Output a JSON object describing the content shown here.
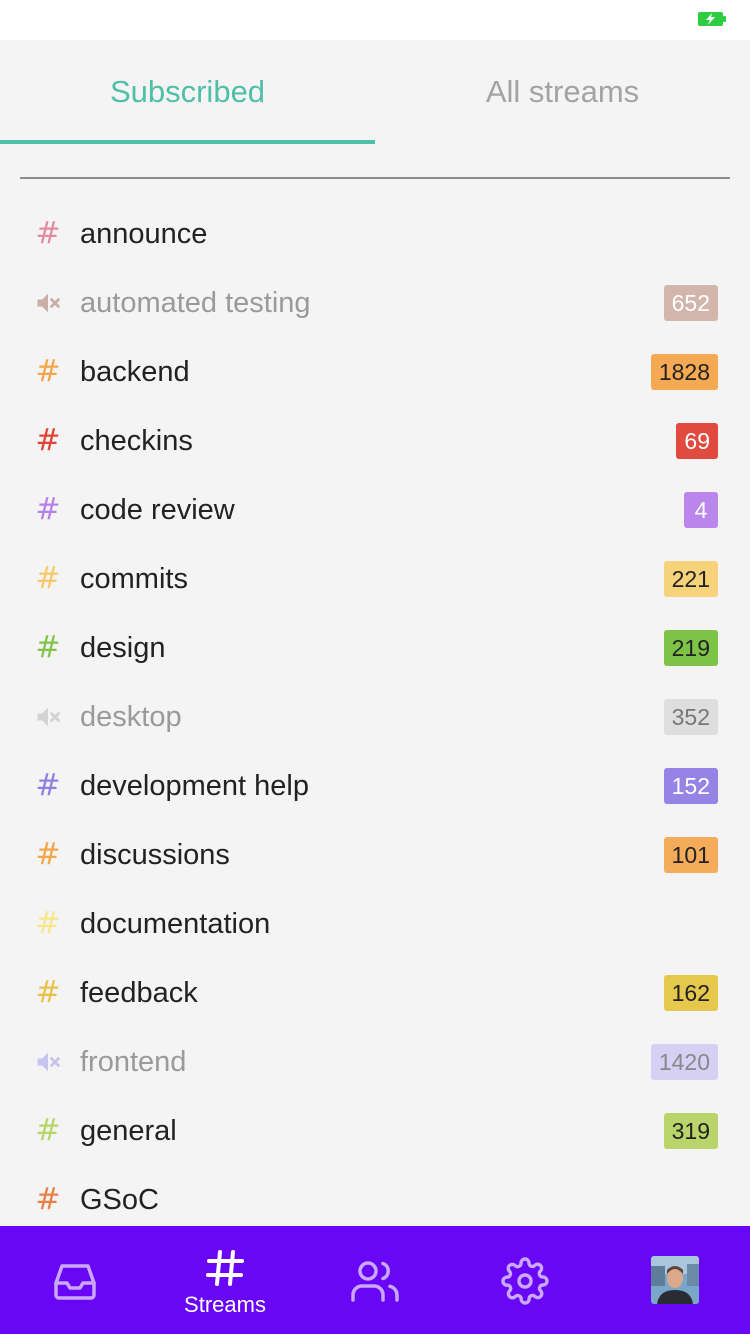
{
  "tabs": [
    {
      "label": "Subscribed",
      "active": true
    },
    {
      "label": "All streams",
      "active": false
    }
  ],
  "streams": [
    {
      "name": "announce",
      "color": "#e58aa3",
      "muted": false,
      "unread": "",
      "badge_bg": "",
      "badge_fg": ""
    },
    {
      "name": "automated testing",
      "color": "#c9afa6",
      "muted": true,
      "unread": "652",
      "badge_bg": "#d2b6ab",
      "badge_fg": "#ffffff"
    },
    {
      "name": "backend",
      "color": "#f3a64b",
      "muted": false,
      "unread": "1828",
      "badge_bg": "#f5a952",
      "badge_fg": "#222222"
    },
    {
      "name": "checkins",
      "color": "#e0453a",
      "muted": false,
      "unread": "69",
      "badge_bg": "#e04a3f",
      "badge_fg": "#ffffff"
    },
    {
      "name": "code review",
      "color": "#b582e8",
      "muted": false,
      "unread": "4",
      "badge_bg": "#bb86ec",
      "badge_fg": "#ffffff"
    },
    {
      "name": "commits",
      "color": "#f7c96a",
      "muted": false,
      "unread": "221",
      "badge_bg": "#f6d27b",
      "badge_fg": "#222222"
    },
    {
      "name": "design",
      "color": "#83c34a",
      "muted": false,
      "unread": "219",
      "badge_bg": "#7dc446",
      "badge_fg": "#222222"
    },
    {
      "name": "desktop",
      "color": "#d3d3d3",
      "muted": true,
      "unread": "352",
      "badge_bg": "#dedede",
      "badge_fg": "#777777"
    },
    {
      "name": "development help",
      "color": "#8d80e0",
      "muted": false,
      "unread": "152",
      "badge_bg": "#9584e6",
      "badge_fg": "#ffffff"
    },
    {
      "name": "discussions",
      "color": "#f3a64b",
      "muted": false,
      "unread": "101",
      "badge_bg": "#f4ab5a",
      "badge_fg": "#222222"
    },
    {
      "name": "documentation",
      "color": "#f8e68a",
      "muted": false,
      "unread": "",
      "badge_bg": "",
      "badge_fg": ""
    },
    {
      "name": "feedback",
      "color": "#e6c24a",
      "muted": false,
      "unread": "162",
      "badge_bg": "#e6c84c",
      "badge_fg": "#222222"
    },
    {
      "name": "frontend",
      "color": "#c9c3ef",
      "muted": true,
      "unread": "1420",
      "badge_bg": "#d5d0f4",
      "badge_fg": "#888888"
    },
    {
      "name": "general",
      "color": "#b6d56a",
      "muted": false,
      "unread": "319",
      "badge_bg": "#b8d46a",
      "badge_fg": "#222222"
    },
    {
      "name": "GSoC",
      "color": "#e8804a",
      "muted": false,
      "unread": "",
      "badge_bg": "",
      "badge_fg": ""
    }
  ],
  "tabbar": {
    "items": [
      {
        "icon": "inbox-icon",
        "label": ""
      },
      {
        "icon": "hash-icon",
        "label": "Streams",
        "active": true
      },
      {
        "icon": "people-icon",
        "label": ""
      },
      {
        "icon": "settings-icon",
        "label": ""
      },
      {
        "icon": "avatar",
        "label": ""
      }
    ]
  },
  "colors": {
    "accent": "#4fbfa8",
    "tabbar_bg": "#6a06f6",
    "battery": "#2ecc40"
  }
}
